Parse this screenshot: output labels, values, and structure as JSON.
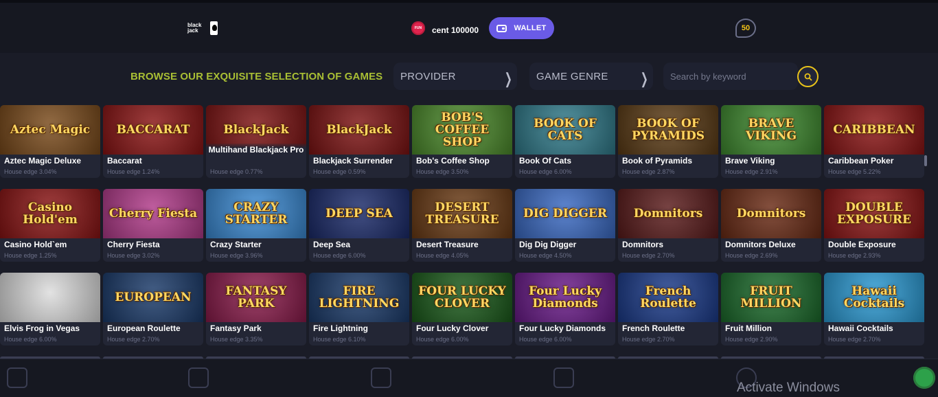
{
  "header": {
    "logo_text": "black JACK",
    "coin_label": "FUN",
    "balance": "cent 100000",
    "wallet_label": "WALLET",
    "notification_count": "50"
  },
  "filters": {
    "title": "BROWSE OUR EXQUISITE SELECTION OF GAMES",
    "provider_label": "PROVIDER",
    "genre_label": "GAME GENRE",
    "search_placeholder": "Search by keyword"
  },
  "games": [
    {
      "name": "Aztec Magic Deluxe",
      "edge": "House edge 3.04%",
      "art": "Aztec Magic",
      "bg": "#7a4a1a"
    },
    {
      "name": "Baccarat",
      "edge": "House edge 1.24%",
      "art": "BACCARAT",
      "bg": "#8a1313"
    },
    {
      "name": "Multihand Blackjack Pro",
      "edge": "House edge 0.77%",
      "art": "BlackJack",
      "bg": "#7d1212"
    },
    {
      "name": "Blackjack Surrender",
      "edge": "House edge 0.59%",
      "art": "BlackJack",
      "bg": "#7d1212"
    },
    {
      "name": "Bob's Coffee Shop",
      "edge": "House edge 3.50%",
      "art": "BOB'S COFFEE SHOP",
      "bg": "#4b8a2a"
    },
    {
      "name": "Book Of Cats",
      "edge": "House edge 6.00%",
      "art": "BOOK OF CATS",
      "bg": "#2f7a8a"
    },
    {
      "name": "Book of Pyramids",
      "edge": "House edge 2.87%",
      "art": "BOOK OF PYRAMIDS",
      "bg": "#5a3a14"
    },
    {
      "name": "Brave Viking",
      "edge": "House edge 2.91%",
      "art": "BRAVE VIKING",
      "bg": "#3e8a2e"
    },
    {
      "name": "Caribbean Poker",
      "edge": "House edge 5.22%",
      "art": "CARIBBEAN",
      "bg": "#8a1313"
    },
    {
      "name": "Casino Hold`em",
      "edge": "House edge 1.25%",
      "art": "Casino Hold'em",
      "bg": "#8a1313"
    },
    {
      "name": "Cherry Fiesta",
      "edge": "House edge 3.02%",
      "art": "Cherry Fiesta",
      "bg": "#b23a8a"
    },
    {
      "name": "Crazy Starter",
      "edge": "House edge 3.96%",
      "art": "CRAZY STARTER",
      "bg": "#3a8ad4"
    },
    {
      "name": "Deep Sea",
      "edge": "House edge 6.00%",
      "art": "DEEP SEA",
      "bg": "#1a2a6a"
    },
    {
      "name": "Desert Treasure",
      "edge": "House edge 4.05%",
      "art": "DESERT TREASURE",
      "bg": "#6a3a14"
    },
    {
      "name": "Dig Dig Digger",
      "edge": "House edge 4.50%",
      "art": "DIG DIGGER",
      "bg": "#3a6ac4"
    },
    {
      "name": "Domnitors",
      "edge": "House edge 2.70%",
      "art": "Domnitors",
      "bg": "#5a1a1a"
    },
    {
      "name": "Domnitors Deluxe",
      "edge": "House edge 2.69%",
      "art": "Domnitors",
      "bg": "#6a2a14"
    },
    {
      "name": "Double Exposure",
      "edge": "House edge 2.93%",
      "art": "DOUBLE EXPOSURE",
      "bg": "#8a1313"
    },
    {
      "name": "Elvis Frog in Vegas",
      "edge": "House edge 6.00%",
      "art": "",
      "bg": "#dcdcdc"
    },
    {
      "name": "European Roulette",
      "edge": "House edge 2.70%",
      "art": "EUROPEAN",
      "bg": "#1a3a6a"
    },
    {
      "name": "Fantasy Park",
      "edge": "House edge 3.35%",
      "art": "FANTASY PARK",
      "bg": "#8a1a4a"
    },
    {
      "name": "Fire Lightning",
      "edge": "House edge 6.10%",
      "art": "FIRE LIGHTNING",
      "bg": "#1a3a6a"
    },
    {
      "name": "Four Lucky Clover",
      "edge": "House edge 6.00%",
      "art": "FOUR LUCKY CLOVER",
      "bg": "#1a5a1a"
    },
    {
      "name": "Four Lucky Diamonds",
      "edge": "House edge 6.00%",
      "art": "Four Lucky Diamonds",
      "bg": "#6a1a8a"
    },
    {
      "name": "French Roulette",
      "edge": "House edge 2.70%",
      "art": "French Roulette",
      "bg": "#1a3a8a"
    },
    {
      "name": "Fruit Million",
      "edge": "House edge 2.90%",
      "art": "FRUIT MILLION",
      "bg": "#1a6a2a"
    },
    {
      "name": "Hawaii Cocktails",
      "edge": "House edge 2.70%",
      "art": "Hawaii Cocktails",
      "bg": "#2a9ad4"
    }
  ],
  "bottom_nav": {
    "watermark": "Activate Windows"
  }
}
